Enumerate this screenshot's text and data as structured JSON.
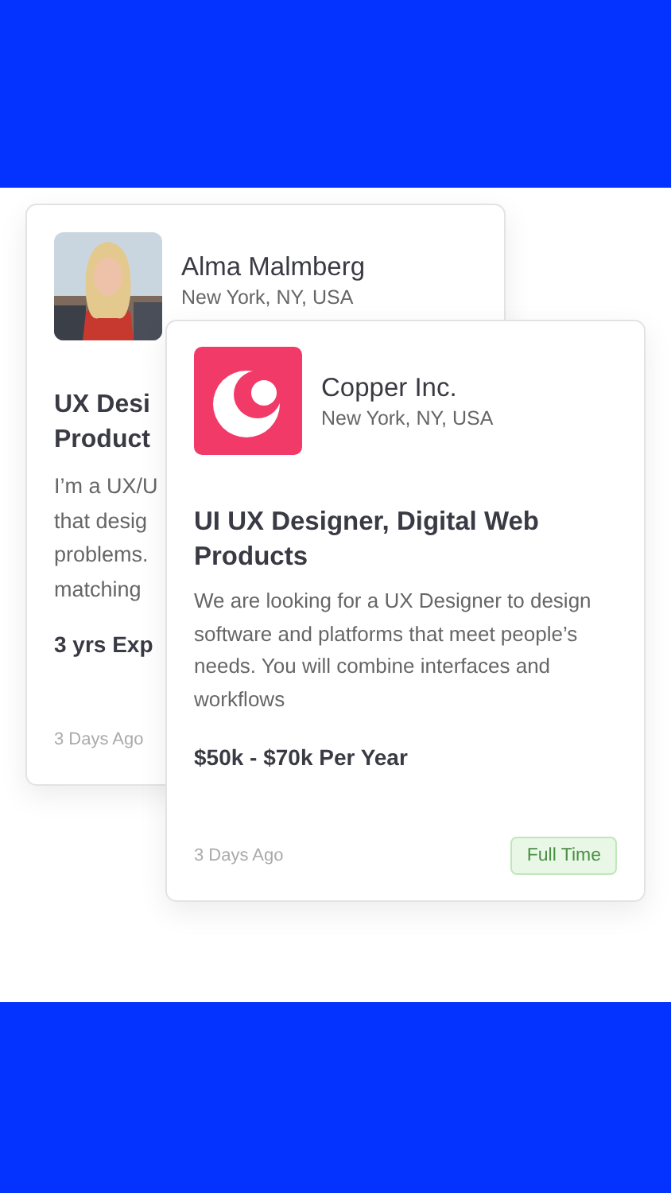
{
  "profile_card": {
    "name": "Alma Malmberg",
    "location": "New York, NY, USA",
    "title_lines": [
      "UX Desi",
      "Product"
    ],
    "bio_lines": [
      "I’m a UX/U",
      "that desig",
      "problems.",
      "matching"
    ],
    "experience": "3 yrs Exp",
    "posted": "3 Days Ago"
  },
  "job_card": {
    "company": "Copper Inc.",
    "location": "New York, NY, USA",
    "title": "UI UX Designer, Digital Web Products",
    "description": "We are looking for a UX Designer to design software and platforms that meet people’s needs. You will combine interfaces and workflows",
    "salary": "$50k - $70k Per Year",
    "posted": "3 Days Ago",
    "tag": "Full Time"
  }
}
